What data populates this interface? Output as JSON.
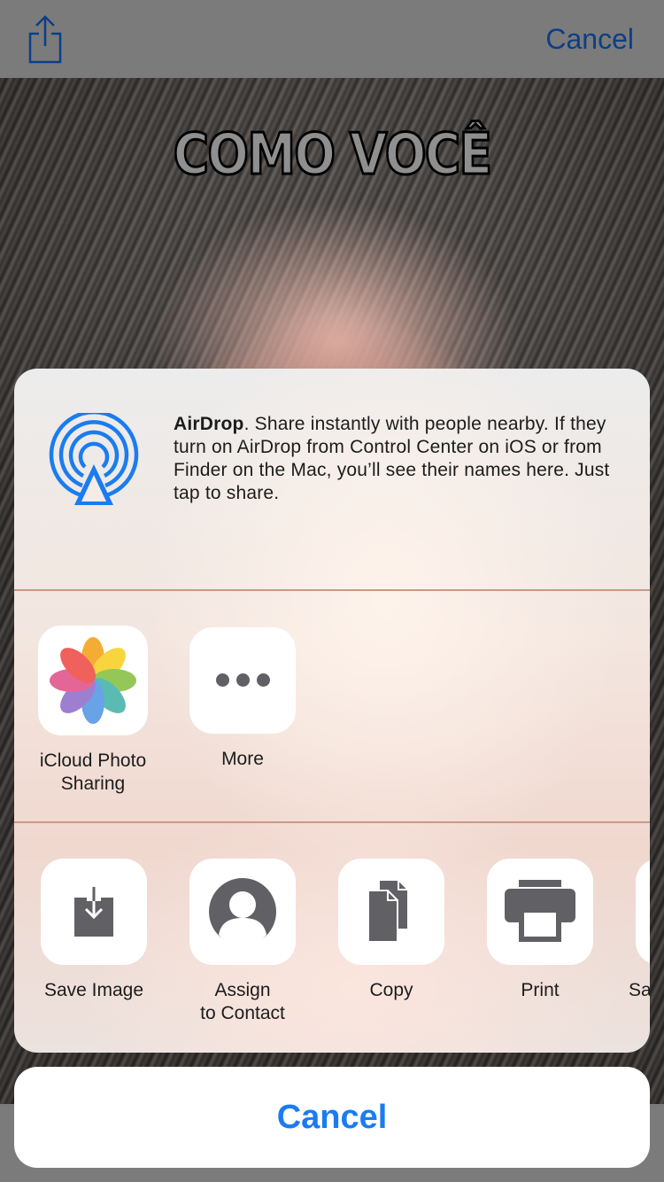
{
  "navbar": {
    "share_icon": "share-icon",
    "cancel_label": "Cancel"
  },
  "background": {
    "meme_top_text": "COMO VOCÊ"
  },
  "airdrop": {
    "icon": "airdrop-icon",
    "title": "AirDrop",
    "description": ". Share instantly with people nearby. If they turn on AirDrop from Control Center on iOS or from Finder on the Mac, you’ll see their names here. Just tap to share."
  },
  "share_row": [
    {
      "icon": "photos-icon",
      "label_line1": "iCloud Photo",
      "label_line2": "Sharing"
    },
    {
      "icon": "more-icon",
      "label_line1": "More"
    }
  ],
  "action_row": [
    {
      "icon": "save-image-icon",
      "label_line1": "Save Image"
    },
    {
      "icon": "contact-icon",
      "label_line1": "Assign",
      "label_line2": "to Contact"
    },
    {
      "icon": "copy-icon",
      "label_line1": "Copy"
    },
    {
      "icon": "print-icon",
      "label_line1": "Print"
    },
    {
      "icon": "partial-icon",
      "label_line1": "Sa"
    }
  ],
  "cancel_label": "Cancel",
  "colors": {
    "accent": "#1a7cf0",
    "nav_tint": "#0c3f86",
    "icon_gray": "#616064"
  }
}
